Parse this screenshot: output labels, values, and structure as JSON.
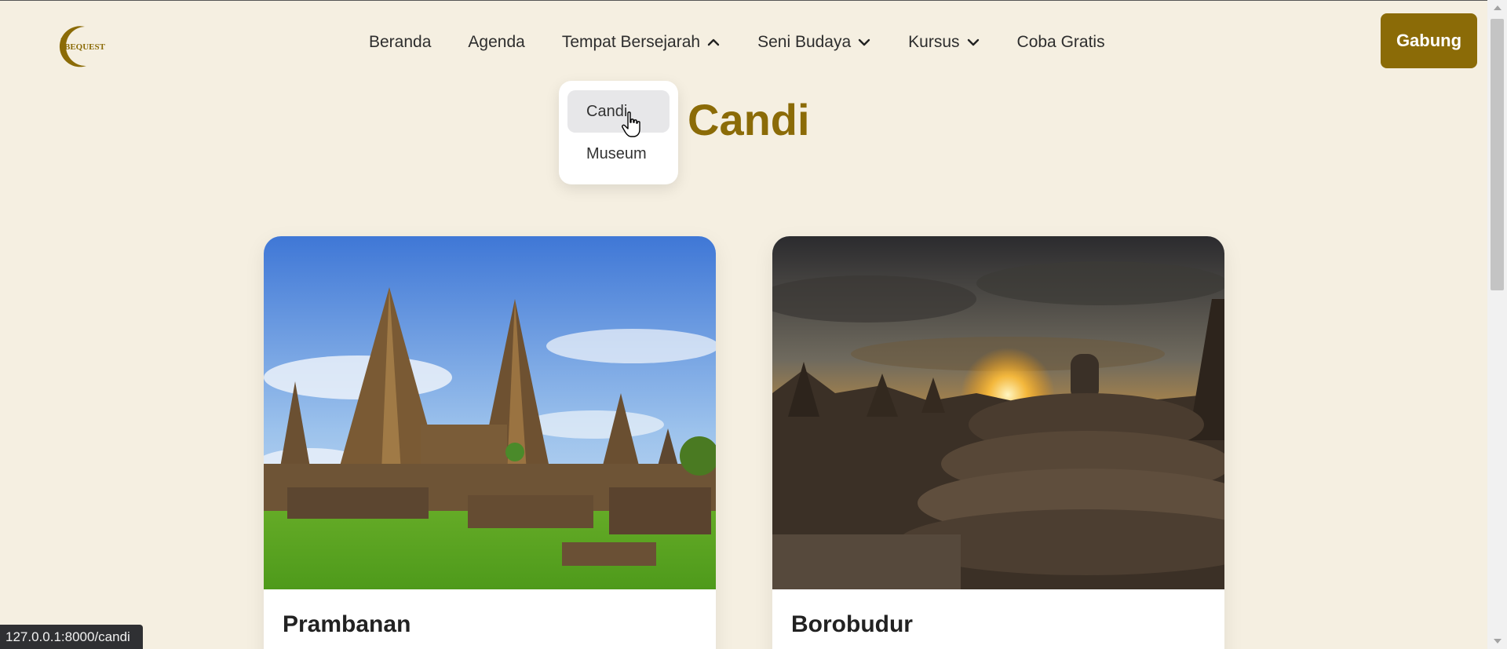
{
  "brand": {
    "logo_text": "BEQUEST",
    "accent_color": "#8b6b07",
    "background_color": "#f5efe1"
  },
  "nav": {
    "items": [
      {
        "label": "Beranda",
        "has_dropdown": false
      },
      {
        "label": "Agenda",
        "has_dropdown": false
      },
      {
        "label": "Tempat Bersejarah",
        "has_dropdown": true,
        "expanded": true
      },
      {
        "label": "Seni Budaya",
        "has_dropdown": true,
        "expanded": false
      },
      {
        "label": "Kursus",
        "has_dropdown": true,
        "expanded": false
      },
      {
        "label": "Coba Gratis",
        "has_dropdown": false
      }
    ],
    "join_label": "Gabung"
  },
  "dropdown": {
    "items": [
      {
        "label": "Candi",
        "hovered": true
      },
      {
        "label": "Museum",
        "hovered": false
      }
    ]
  },
  "page": {
    "title": "Candi"
  },
  "cards": [
    {
      "title": "Prambanan",
      "image": "prambanan-temple-photo"
    },
    {
      "title": "Borobudur",
      "image": "borobudur-sunset-photo"
    }
  ],
  "status_bar": {
    "url": "127.0.0.1:8000/candi"
  }
}
